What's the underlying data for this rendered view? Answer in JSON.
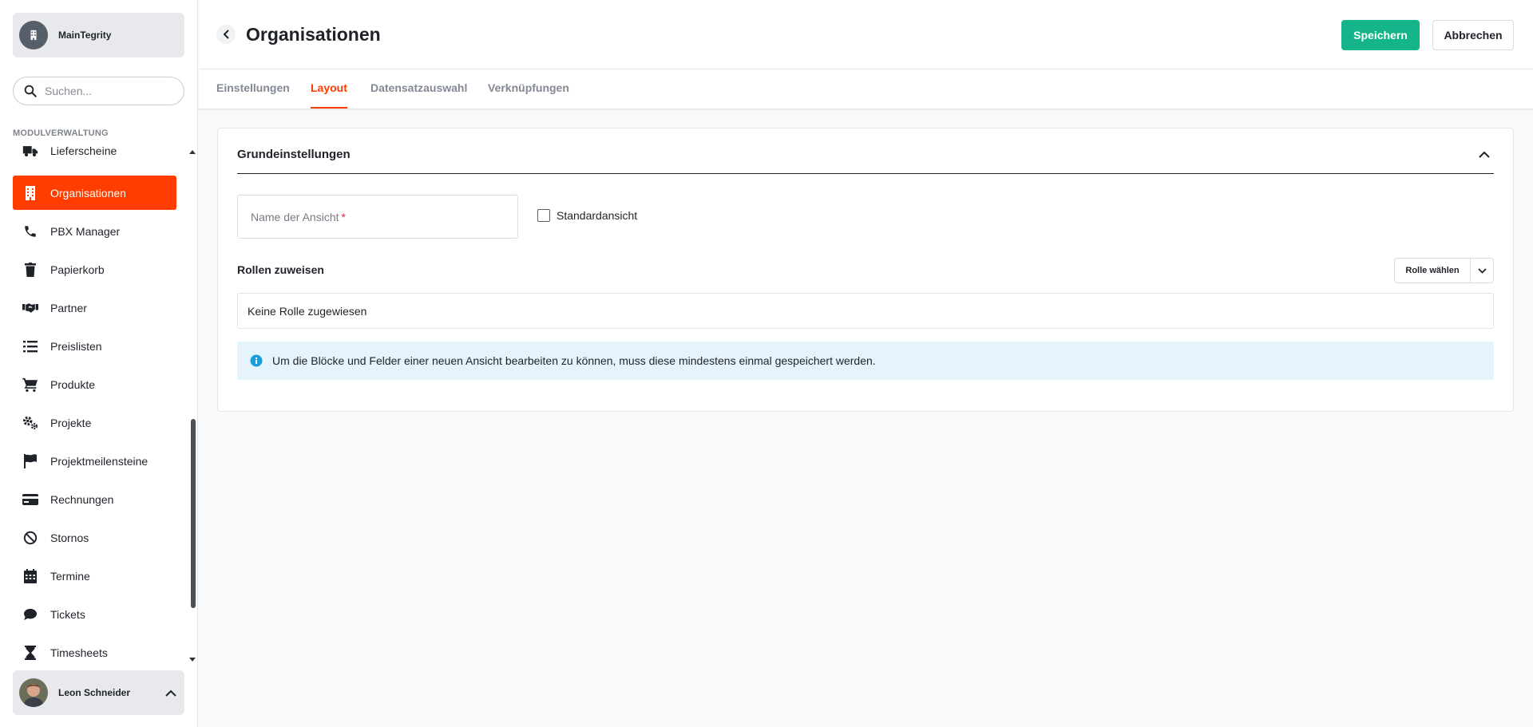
{
  "workspace": {
    "name": "MainTegrity"
  },
  "search": {
    "placeholder": "Suchen..."
  },
  "sidebar": {
    "section_label": "MODULVERWALTUNG",
    "items": [
      {
        "label": "Lieferscheine",
        "icon": "truck-icon"
      },
      {
        "label": "Organisationen",
        "icon": "building-icon",
        "active": true
      },
      {
        "label": "PBX Manager",
        "icon": "phone-icon"
      },
      {
        "label": "Papierkorb",
        "icon": "trash-icon"
      },
      {
        "label": "Partner",
        "icon": "handshake-icon"
      },
      {
        "label": "Preislisten",
        "icon": "list-icon"
      },
      {
        "label": "Produkte",
        "icon": "cart-icon"
      },
      {
        "label": "Projekte",
        "icon": "gears-icon"
      },
      {
        "label": "Projektmeilensteine",
        "icon": "flag-icon"
      },
      {
        "label": "Rechnungen",
        "icon": "credit-card-icon"
      },
      {
        "label": "Stornos",
        "icon": "ban-icon"
      },
      {
        "label": "Termine",
        "icon": "calendar-icon"
      },
      {
        "label": "Tickets",
        "icon": "chat-bubble-icon"
      },
      {
        "label": "Timesheets",
        "icon": "hourglass-icon"
      }
    ]
  },
  "user": {
    "name": "Leon Schneider"
  },
  "header": {
    "title": "Organisationen",
    "save_label": "Speichern",
    "cancel_label": "Abbrechen"
  },
  "tabs": [
    {
      "label": "Einstellungen",
      "active": false
    },
    {
      "label": "Layout",
      "active": true
    },
    {
      "label": "Datensatzauswahl",
      "active": false
    },
    {
      "label": "Verknüpfungen",
      "active": false
    }
  ],
  "card": {
    "title": "Grundeinstellungen",
    "name_field_placeholder": "Name der Ansicht",
    "required_marker": "*",
    "default_view_label": "Standardansicht",
    "roles_title": "Rollen zuweisen",
    "role_button_label": "Rolle wählen",
    "roles_empty": "Keine Rolle zugewiesen",
    "info_text": "Um die Blöcke und Felder einer neuen Ansicht bearbeiten zu können, muss diese mindestens einmal gespeichert werden."
  },
  "colors": {
    "accent": "#ff3d00",
    "save": "#14b58a",
    "info_bg": "#e5f4fc",
    "info_icon": "#1a9fd9"
  }
}
